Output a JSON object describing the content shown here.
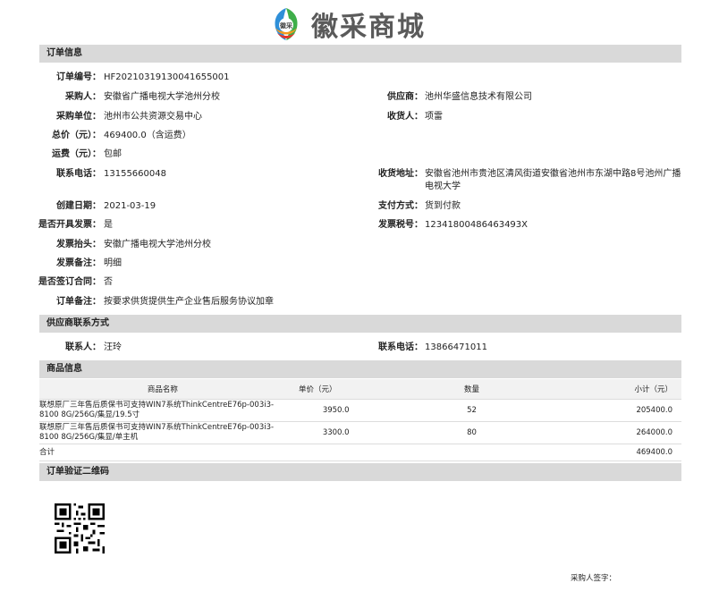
{
  "brand": {
    "name": "徽采商城",
    "logo_badge": "徽采"
  },
  "sections": {
    "order_info": "订单信息",
    "supplier_contact": "供应商联系方式",
    "goods_info": "商品信息",
    "qr_title": "订单验证二维码"
  },
  "order": {
    "number_label": "订单编号",
    "number": "HF20210319130041655001",
    "buyer_label": "采购人",
    "buyer": "安徽省广播电视大学池州分校",
    "supplier_label": "供应商",
    "supplier": "池州华盛信息技术有限公司",
    "unit_label": "采购单位",
    "unit": "池州市公共资源交易中心",
    "receiver_label": "收货人",
    "receiver": "项雷",
    "total_label": "总价（元）",
    "total": "469400.0（含运费）",
    "freight_label": "运费（元）",
    "freight": "包邮",
    "phone_label": "联系电话",
    "phone": "13155660048",
    "address_label": "收货地址",
    "address": "安徽省池州市贵池区清风街道安徽省池州市东湖中路8号池州广播电视大学",
    "date_label": "创建日期",
    "date": "2021-03-19",
    "pay_label": "支付方式",
    "pay": "货到付款",
    "invoice_label": "是否开具发票",
    "invoice": "是",
    "tax_label": "发票税号",
    "tax": "12341800486463493X",
    "inv_title_label": "发票抬头",
    "inv_title": "安徽广播电视大学池州分校",
    "inv_note_label": "发票备注",
    "inv_note": "明细",
    "contract_label": "是否签订合同",
    "contract": "否",
    "note_label": "订单备注",
    "note": "按要求供货提供生产企业售后服务协议加章"
  },
  "supplier_contact": {
    "person_label": "联系人",
    "person": "汪玲",
    "phone_label": "联系电话",
    "phone": "13866471011"
  },
  "goods": {
    "headers": [
      "商品名称",
      "单价（元）",
      "数量",
      "小计（元）"
    ],
    "rows": [
      {
        "name": "联想原厂三年售后质保书可支持WIN7系统ThinkCentreE76p-003i3-8100 8G/256G/集显/19.5寸",
        "price": "3950.0",
        "qty": "52",
        "subtotal": "205400.0"
      },
      {
        "name": "联想原厂三年售后质保书可支持WIN7系统ThinkCentreE76p-003i3-8100 8G/256G/集显/单主机",
        "price": "3300.0",
        "qty": "80",
        "subtotal": "264000.0"
      }
    ],
    "total_label": "合计",
    "total": "469400.0"
  },
  "signature_label": "采购人签字："
}
